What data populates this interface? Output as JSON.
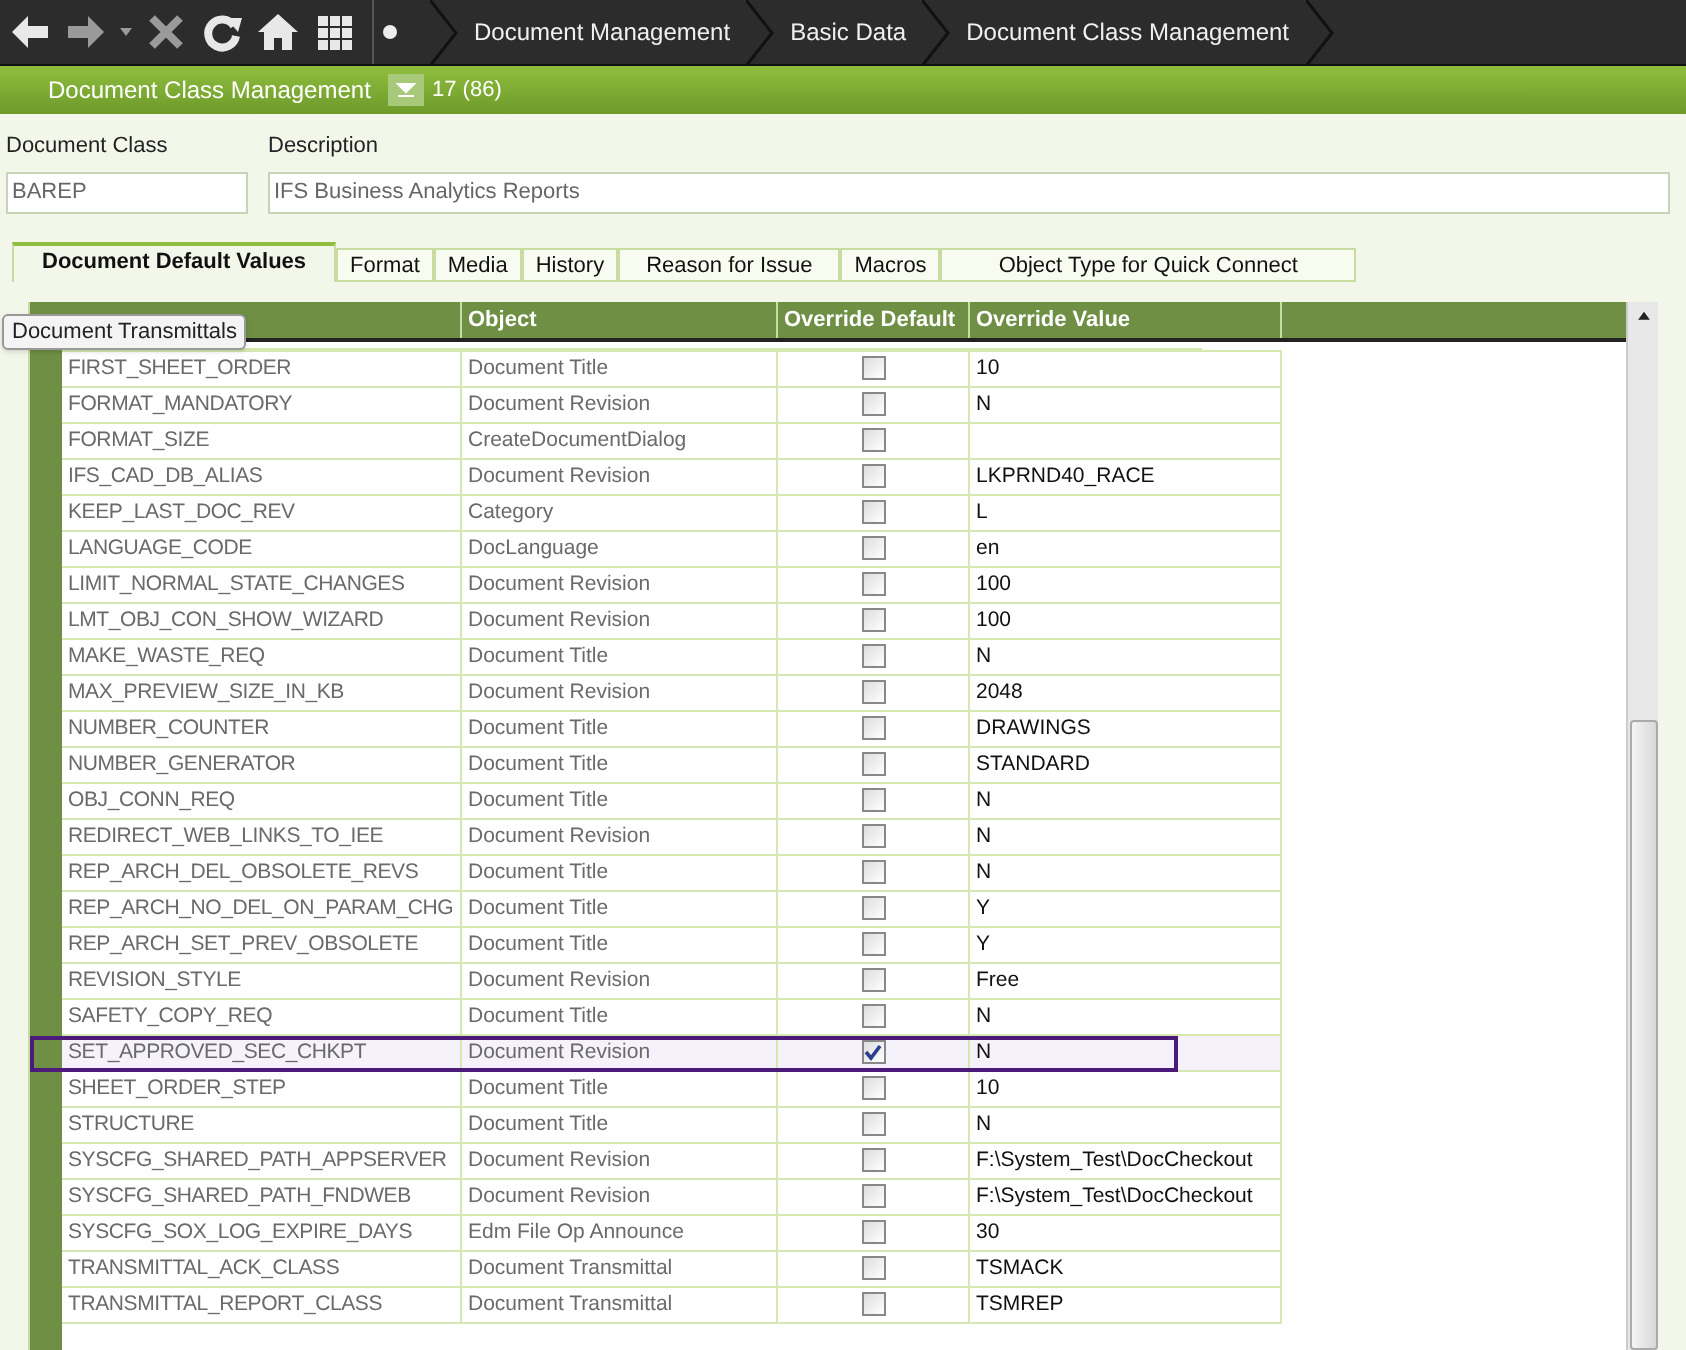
{
  "breadcrumbs": [
    "Document Management",
    "Basic Data",
    "Document Class Management"
  ],
  "header": {
    "title": "Document Class Management",
    "count": "17 (86)"
  },
  "form": {
    "fields": [
      {
        "label": "Document Class",
        "value": "BAREP"
      },
      {
        "label": "Description",
        "value": "IFS Business Analytics Reports"
      }
    ]
  },
  "tabs": [
    {
      "label": "Document Default Values",
      "selected": true
    },
    {
      "label": "Format",
      "selected": false
    },
    {
      "label": "Media",
      "selected": false
    },
    {
      "label": "History",
      "selected": false
    },
    {
      "label": "Reason for Issue",
      "selected": false
    },
    {
      "label": "Macros",
      "selected": false
    },
    {
      "label": "Object Type for Quick Connect",
      "selected": false
    }
  ],
  "tooltip": "Document Transmittals",
  "table": {
    "columns": [
      "Object",
      "Override Default",
      "Override Value"
    ],
    "rows": [
      {
        "parameter": "FIRST_SHEET_ORDER",
        "object": "Document Title",
        "override": false,
        "value": "10",
        "selected": false
      },
      {
        "parameter": "FORMAT_MANDATORY",
        "object": "Document Revision",
        "override": false,
        "value": "N",
        "selected": false
      },
      {
        "parameter": "FORMAT_SIZE",
        "object": "CreateDocumentDialog",
        "override": false,
        "value": "",
        "selected": false
      },
      {
        "parameter": "IFS_CAD_DB_ALIAS",
        "object": "Document Revision",
        "override": false,
        "value": "LKPRND40_RACE",
        "selected": false
      },
      {
        "parameter": "KEEP_LAST_DOC_REV",
        "object": "Category",
        "override": false,
        "value": "L",
        "selected": false
      },
      {
        "parameter": "LANGUAGE_CODE",
        "object": "DocLanguage",
        "override": false,
        "value": "en",
        "selected": false
      },
      {
        "parameter": "LIMIT_NORMAL_STATE_CHANGES",
        "object": "Document Revision",
        "override": false,
        "value": "100",
        "selected": false
      },
      {
        "parameter": "LMT_OBJ_CON_SHOW_WIZARD",
        "object": "Document Revision",
        "override": false,
        "value": "100",
        "selected": false
      },
      {
        "parameter": "MAKE_WASTE_REQ",
        "object": "Document Title",
        "override": false,
        "value": "N",
        "selected": false
      },
      {
        "parameter": "MAX_PREVIEW_SIZE_IN_KB",
        "object": "Document Revision",
        "override": false,
        "value": "2048",
        "selected": false
      },
      {
        "parameter": "NUMBER_COUNTER",
        "object": "Document Title",
        "override": false,
        "value": "DRAWINGS",
        "selected": false
      },
      {
        "parameter": "NUMBER_GENERATOR",
        "object": "Document Title",
        "override": false,
        "value": "STANDARD",
        "selected": false
      },
      {
        "parameter": "OBJ_CONN_REQ",
        "object": "Document Title",
        "override": false,
        "value": "N",
        "selected": false
      },
      {
        "parameter": "REDIRECT_WEB_LINKS_TO_IEE",
        "object": "Document Revision",
        "override": false,
        "value": "N",
        "selected": false
      },
      {
        "parameter": "REP_ARCH_DEL_OBSOLETE_REVS",
        "object": "Document Title",
        "override": false,
        "value": "N",
        "selected": false
      },
      {
        "parameter": "REP_ARCH_NO_DEL_ON_PARAM_CHG",
        "object": "Document Title",
        "override": false,
        "value": "Y",
        "selected": false
      },
      {
        "parameter": "REP_ARCH_SET_PREV_OBSOLETE",
        "object": "Document Title",
        "override": false,
        "value": "Y",
        "selected": false
      },
      {
        "parameter": "REVISION_STYLE",
        "object": "Document Revision",
        "override": false,
        "value": "Free",
        "selected": false
      },
      {
        "parameter": "SAFETY_COPY_REQ",
        "object": "Document Title",
        "override": false,
        "value": "N",
        "selected": false
      },
      {
        "parameter": "SET_APPROVED_SEC_CHKPT",
        "object": "Document Revision",
        "override": true,
        "value": "N",
        "selected": true
      },
      {
        "parameter": "SHEET_ORDER_STEP",
        "object": "Document Title",
        "override": false,
        "value": "10",
        "selected": false
      },
      {
        "parameter": "STRUCTURE",
        "object": "Document Title",
        "override": false,
        "value": "N",
        "selected": false
      },
      {
        "parameter": "SYSCFG_SHARED_PATH_APPSERVER",
        "object": "Document Revision",
        "override": false,
        "value": "F:\\System_Test\\DocCheckout",
        "selected": false
      },
      {
        "parameter": "SYSCFG_SHARED_PATH_FNDWEB",
        "object": "Document Revision",
        "override": false,
        "value": "F:\\System_Test\\DocCheckout",
        "selected": false
      },
      {
        "parameter": "SYSCFG_SOX_LOG_EXPIRE_DAYS",
        "object": "Edm File Op Announce",
        "override": false,
        "value": "30",
        "selected": false
      },
      {
        "parameter": "TRANSMITTAL_ACK_CLASS",
        "object": "Document Transmittal",
        "override": false,
        "value": "TSMACK",
        "selected": false
      },
      {
        "parameter": "TRANSMITTAL_REPORT_CLASS",
        "object": "Document Transmittal",
        "override": false,
        "value": "TSMREP",
        "selected": false
      }
    ]
  }
}
